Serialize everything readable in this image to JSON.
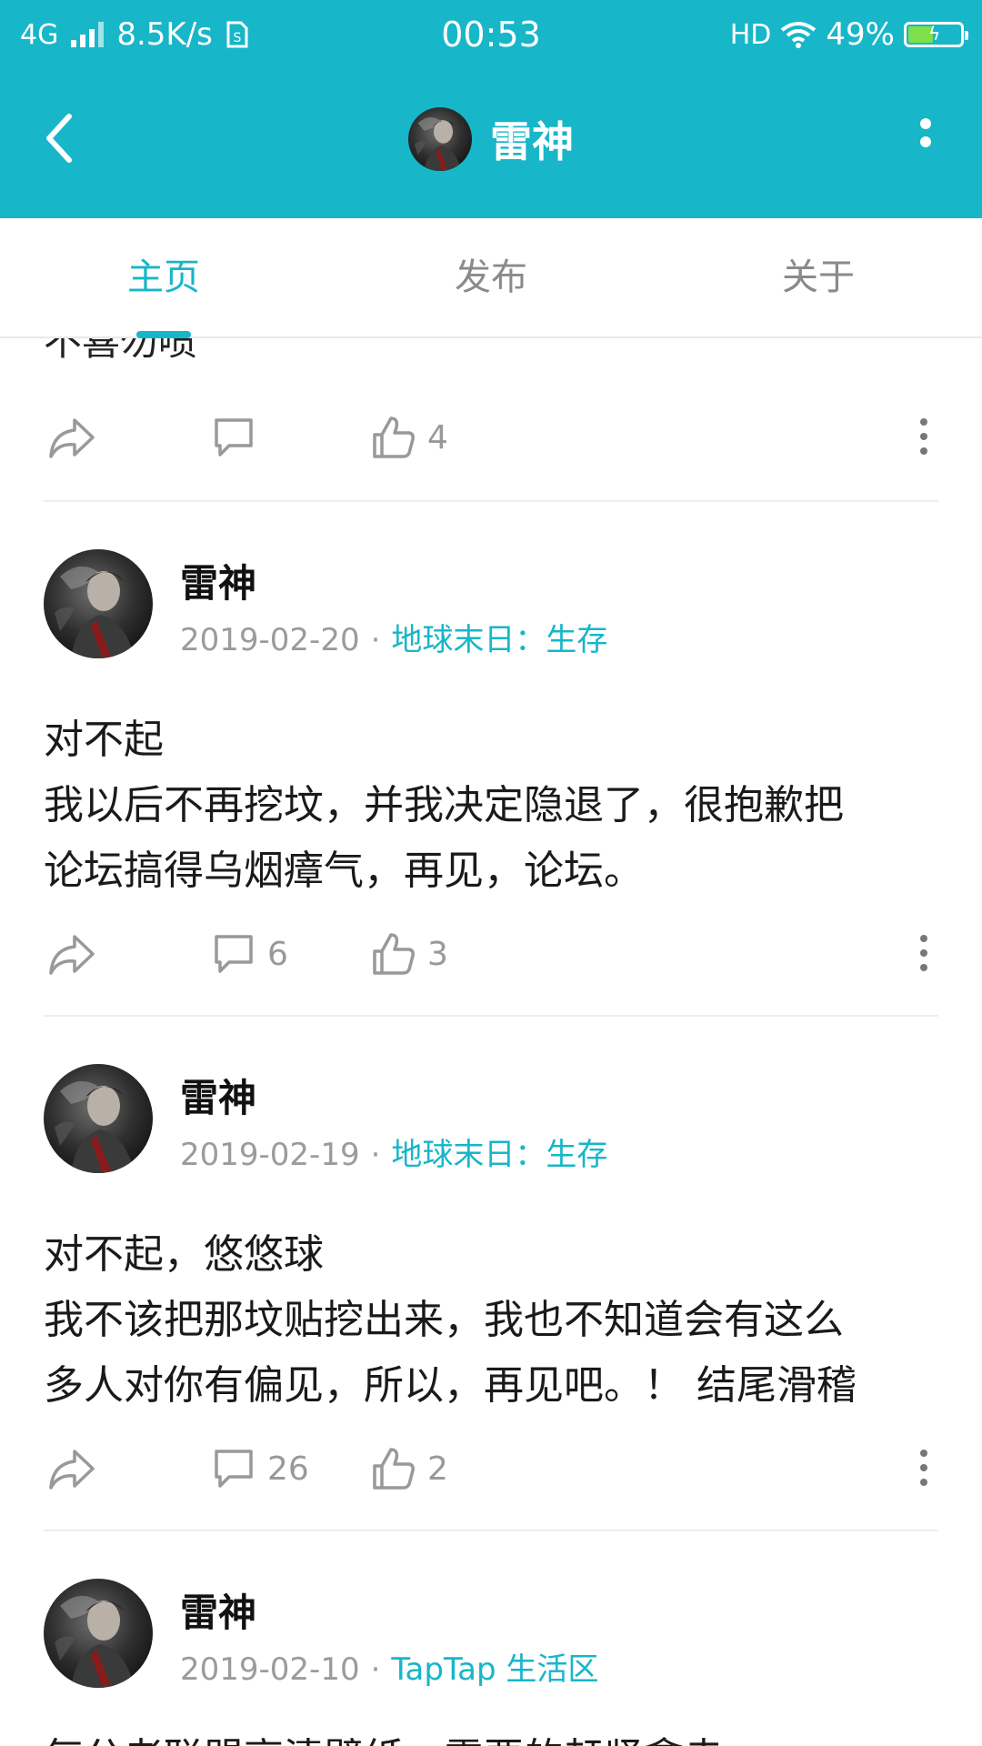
{
  "theme": {
    "accent": "#17b6c8"
  },
  "status_bar": {
    "network": "4G",
    "speed": "8.5K/s",
    "time": "00:53",
    "hd": "HD",
    "battery_percent": "49%",
    "battery_level": 0.49,
    "icons": [
      "signal-icon",
      "sim-icon",
      "wifi-icon",
      "battery-icon"
    ]
  },
  "app_bar": {
    "title": "雷神",
    "back_icon": "chevron-left-icon",
    "more_icon": "more-vertical-icon"
  },
  "tabs": [
    {
      "label": "主页",
      "active": true
    },
    {
      "label": "发布",
      "active": false
    },
    {
      "label": "关于",
      "active": false
    }
  ],
  "feed": {
    "cutoff_text": "不喜勿喷",
    "cutoff_actions": {
      "comments": "",
      "likes": "4"
    },
    "posts": [
      {
        "author": "雷神",
        "date": "2019-02-20",
        "separator": "·",
        "forum": "地球末日：生存",
        "body_lines": [
          "对不起",
          "我以后不再挖坟，并我决定隐退了，很抱歉把",
          "论坛搞得乌烟瘴气，再见，论坛。"
        ],
        "comments": "6",
        "likes": "3"
      },
      {
        "author": "雷神",
        "date": "2019-02-19",
        "separator": "·",
        "forum": "地球末日：生存",
        "body_lines": [
          "对不起，悠悠球",
          "我不该把那坟贴挖出来，我也不知道会有这么",
          "多人对你有偏见，所以，再见吧。！ 结尾滑稽"
        ],
        "comments": "26",
        "likes": "2"
      },
      {
        "author": "雷神",
        "date": "2019-02-10",
        "separator": "·",
        "forum": "TapTap 生活区",
        "body_lines": [
          "每分老联盟高清壁纸，需要的赶紧拿走"
        ],
        "comments": "",
        "likes": ""
      }
    ]
  }
}
